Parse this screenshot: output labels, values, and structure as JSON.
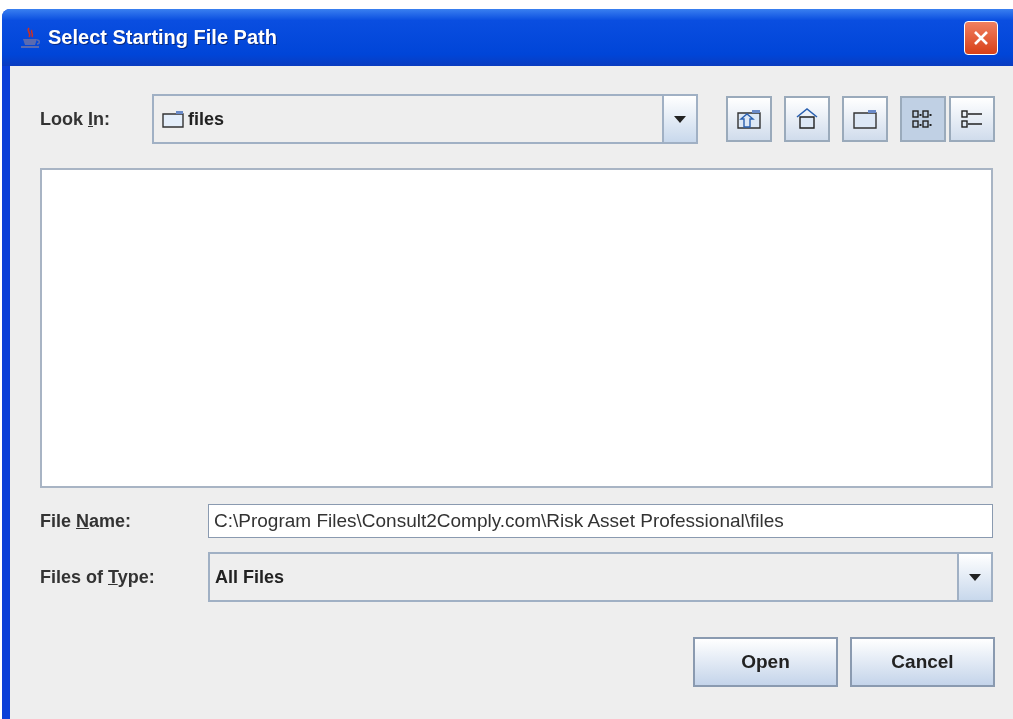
{
  "window": {
    "title": "Select Starting File Path"
  },
  "look_in": {
    "label_parts": [
      "Look ",
      "I",
      "n:"
    ],
    "value": "files"
  },
  "toolbar": [
    {
      "kind": "up",
      "selected": false
    },
    {
      "kind": "home",
      "selected": false
    },
    {
      "kind": "new-folder",
      "selected": false
    },
    {
      "kind": "list",
      "selected": true
    },
    {
      "kind": "details",
      "selected": false
    }
  ],
  "file_name": {
    "label_parts": [
      "File ",
      "N",
      "ame:"
    ],
    "value": "C:\\Program Files\\Consult2Comply.com\\Risk Asset Professional\\files"
  },
  "files_of_type": {
    "label_parts": [
      "Files of ",
      "T",
      "ype:"
    ],
    "value": "All Files"
  },
  "buttons": [
    "Open",
    "Cancel"
  ]
}
